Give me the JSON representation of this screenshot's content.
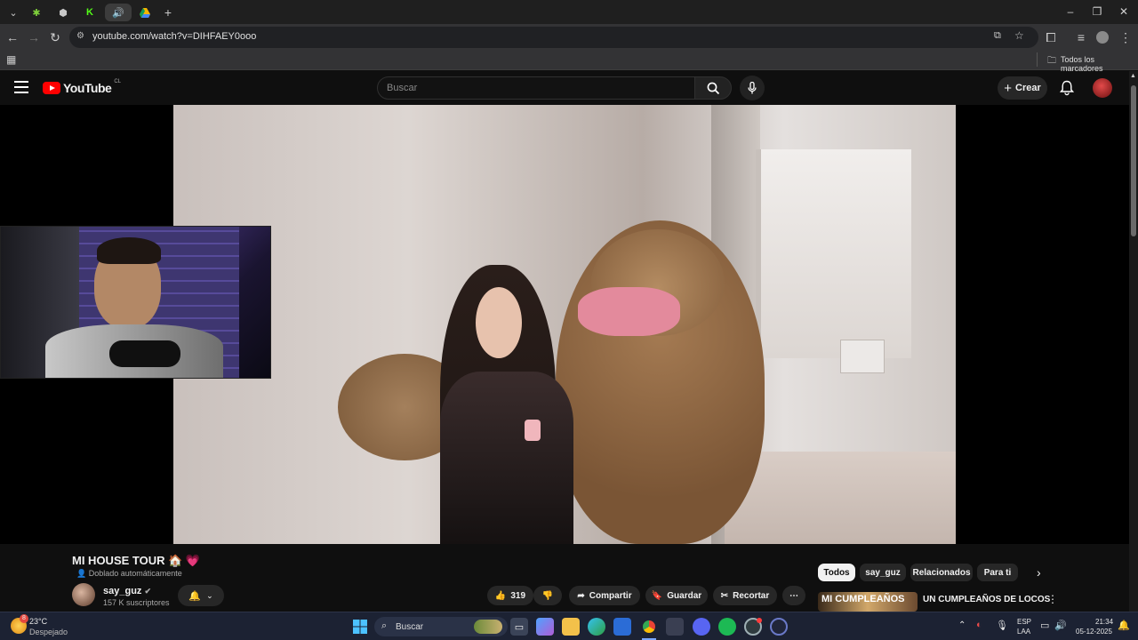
{
  "browser": {
    "url": "youtube.com/watch?v=DIHFAEY0ooo",
    "bookmarks_folder": "Todos los marcadores",
    "new_tab": "+"
  },
  "youtube": {
    "logo_text": "YouTube",
    "region": "CL",
    "search_placeholder": "Buscar",
    "create_label": "Crear"
  },
  "video": {
    "title": "MI HOUSE TOUR 🏠 💗",
    "dub_label": "Doblado automáticamente",
    "channel": "say_guz",
    "subscribers": "157 K suscriptores",
    "likes": "319",
    "share_label": "Compartir",
    "save_label": "Guardar",
    "clip_label": "Recortar"
  },
  "chips": [
    "Todos",
    "say_guz",
    "Relacionados",
    "Para ti"
  ],
  "recommendation": {
    "thumb_text": "MI CUMPLEAÑOS",
    "title": "UN CUMPLEAÑOS DE LOCOS"
  },
  "taskbar": {
    "weather_temp": "23°C",
    "weather_desc": "Despejado",
    "weather_badge": "8",
    "search_label": "Buscar",
    "lang_top": "ESP",
    "lang_bottom": "LAA",
    "time": "21:34",
    "date": "05-12-2025"
  },
  "colors": {
    "yt_red": "#ff0000",
    "background": "#0f0f0f",
    "taskbar": "#1c2233"
  }
}
